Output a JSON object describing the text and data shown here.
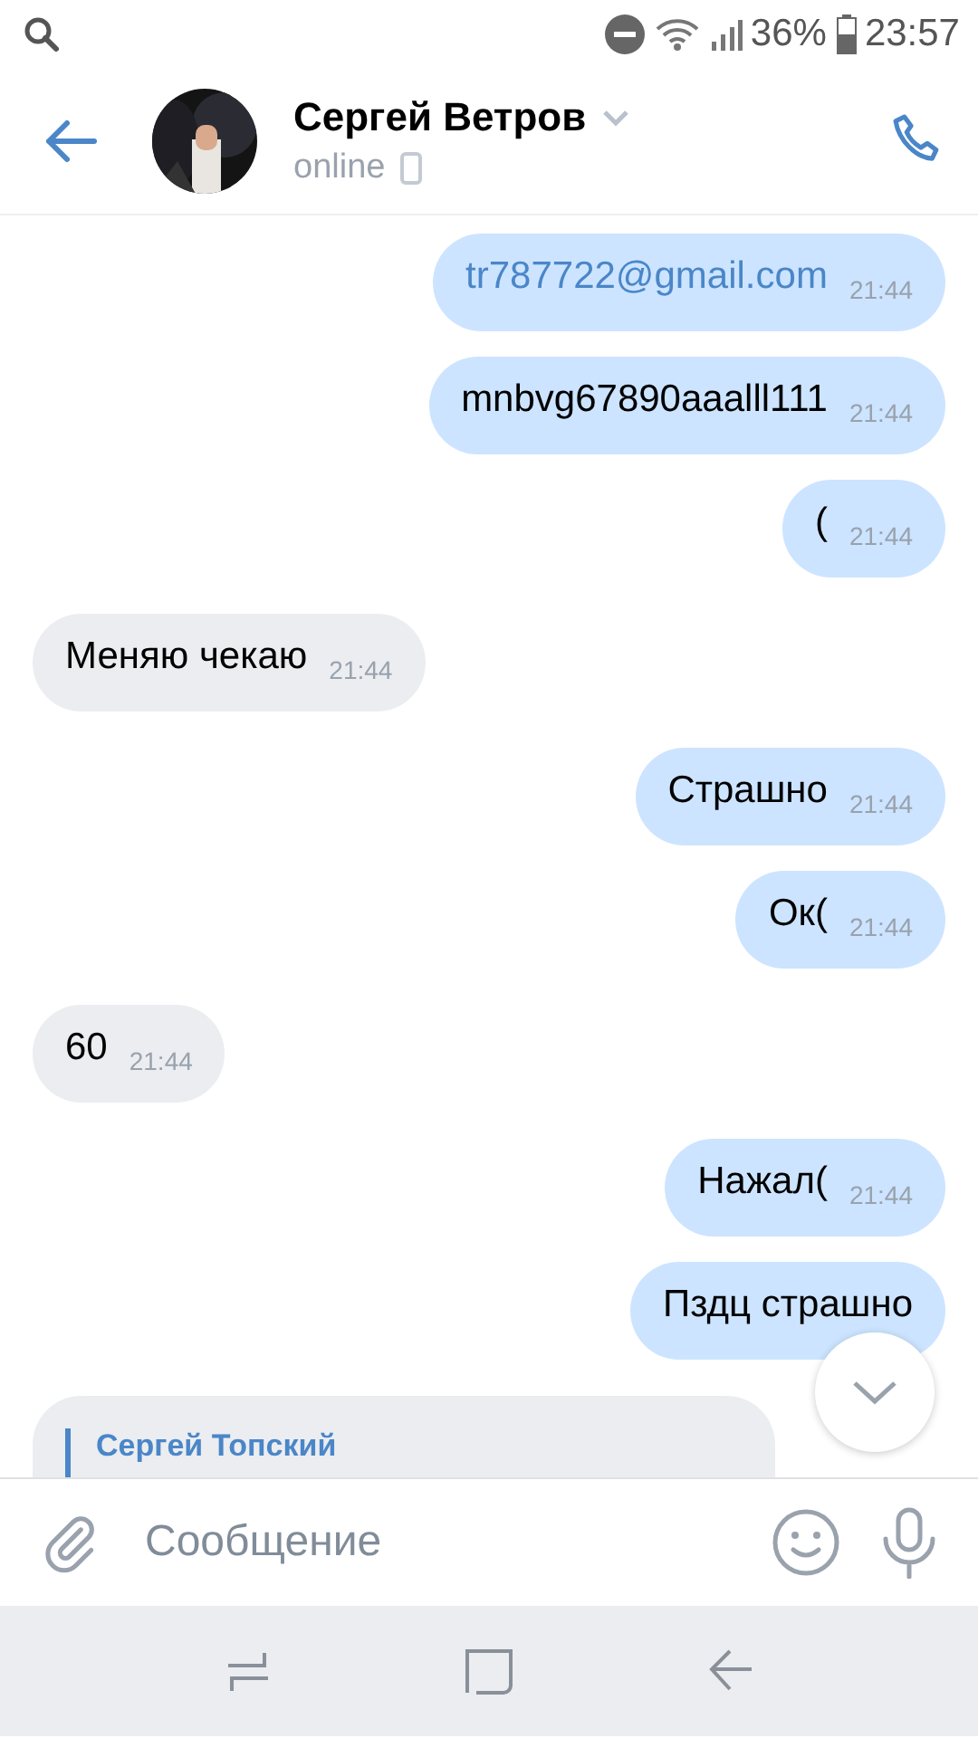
{
  "status_bar": {
    "battery": "36%",
    "time": "23:57"
  },
  "header": {
    "name": "Сергей Ветров",
    "status": "online"
  },
  "messages": [
    {
      "kind": "link",
      "outgoing": true,
      "text": "tr787722@gmail.com",
      "time": "21:44"
    },
    {
      "kind": "text",
      "outgoing": true,
      "text": "mnbvg67890aaalll111",
      "time": "21:44"
    },
    {
      "kind": "text",
      "outgoing": true,
      "text": "(",
      "time": "21:44"
    },
    {
      "kind": "text",
      "outgoing": false,
      "text": "Меняю чекаю",
      "time": "21:44"
    },
    {
      "kind": "text",
      "outgoing": true,
      "text": "Страшно",
      "time": "21:44"
    },
    {
      "kind": "text",
      "outgoing": true,
      "text": "Ок(",
      "time": "21:44"
    },
    {
      "kind": "text",
      "outgoing": false,
      "text": "60",
      "time": "21:44"
    },
    {
      "kind": "text",
      "outgoing": true,
      "text": "Нажал(",
      "time": "21:44"
    },
    {
      "kind": "text",
      "outgoing": true,
      "text": "Пздц страшно"
    },
    {
      "kind": "reply",
      "outgoing": false,
      "quote_author": "Сергей Топский"
    }
  ],
  "composer": {
    "placeholder": "Сообщение"
  }
}
